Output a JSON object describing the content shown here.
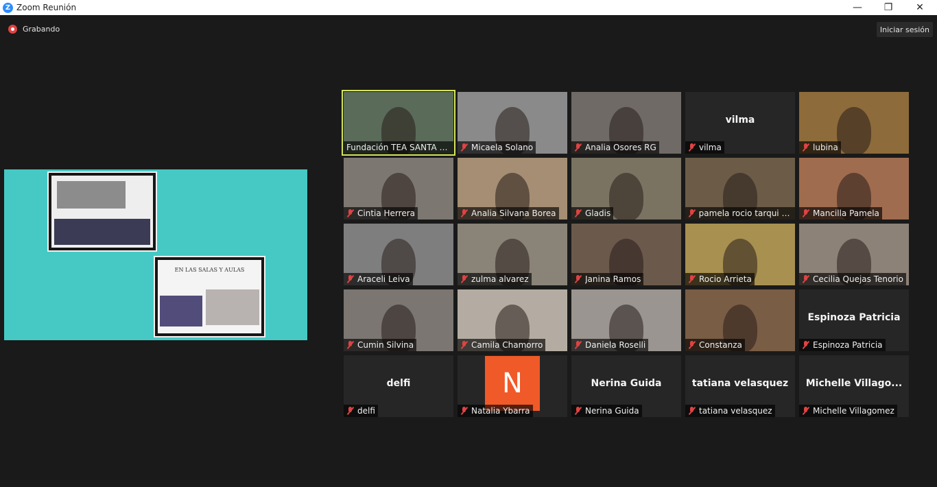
{
  "window": {
    "title": "Zoom Reunión"
  },
  "topbar": {
    "recording_label": "Grabando",
    "signin_label": "Iniciar sesión"
  },
  "shared_screen": {
    "caption": "EN LAS SALAS Y AULAS"
  },
  "avatar_letter": "N",
  "participants": [
    {
      "name": "Fundación TEA SANTA C...",
      "bg": "#5a6b5a"
    },
    {
      "name": "Micaela Solano",
      "bg": "#8a8a8a"
    },
    {
      "name": "Analia Osores RG",
      "bg": "#6f6a66"
    },
    {
      "name": "vilma",
      "big": "vilma"
    },
    {
      "name": "lubina",
      "bg": "#8e6b3a"
    },
    {
      "name": "Cintia Herrera",
      "bg": "#7d7772"
    },
    {
      "name": "Analia Silvana Borea",
      "bg": "#a58e73"
    },
    {
      "name": "Gladis",
      "bg": "#7a7362"
    },
    {
      "name": "pamela rocio tarqui ti...",
      "bg": "#6c5c47"
    },
    {
      "name": "Mancilla Pamela",
      "bg": "#a06c4f"
    },
    {
      "name": "Araceli Leiva",
      "bg": "#7e7e7e"
    },
    {
      "name": "zulma alvarez",
      "bg": "#8a8478"
    },
    {
      "name": "Janina Ramos",
      "bg": "#6b5a4c"
    },
    {
      "name": "Rocio Arrieta",
      "bg": "#a89050"
    },
    {
      "name": "Cecilia Quejas Tenorio",
      "bg": "#8d8278"
    },
    {
      "name": "Cumin Silvina",
      "bg": "#7b7672"
    },
    {
      "name": "Camila Chamorro",
      "bg": "#b4aca2"
    },
    {
      "name": "Daniela Roselli",
      "bg": "#9a9590"
    },
    {
      "name": "Constanza",
      "bg": "#7a5d45"
    },
    {
      "name": "Espinoza Patricia",
      "big": "Espinoza Patricia"
    },
    {
      "name": "delfi",
      "big": "delfi"
    },
    {
      "name": "Natalia Ybarra",
      "avatar": true
    },
    {
      "name": "Nerina Guida",
      "big": "Nerina Guida"
    },
    {
      "name": "tatiana velasquez",
      "big": "tatiana velasquez"
    },
    {
      "name": "Michelle Villagomez",
      "big": "Michelle  Villago..."
    }
  ]
}
